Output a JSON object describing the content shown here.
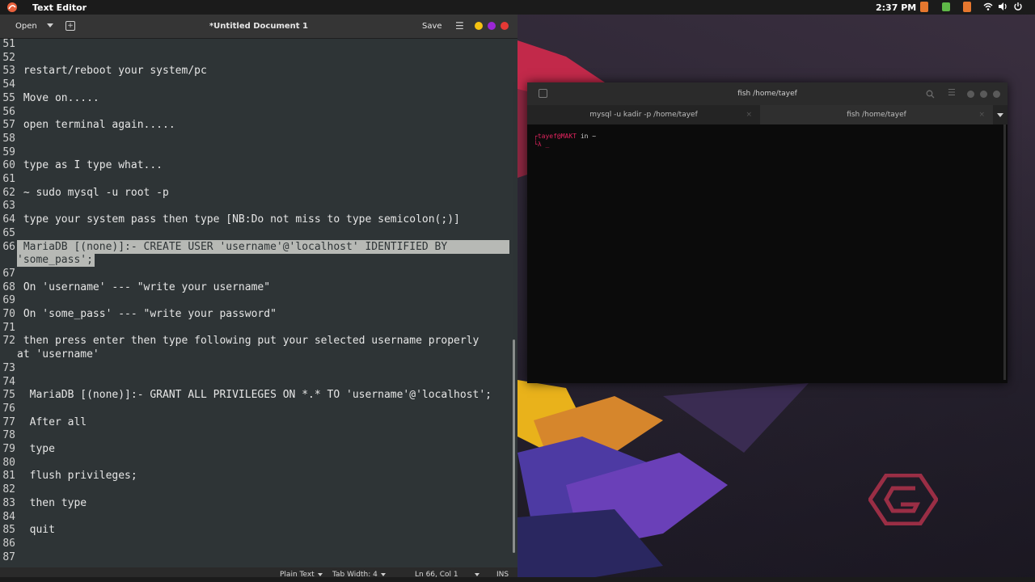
{
  "top_panel": {
    "app_title": "Text Editor",
    "clock": "2:37 PM"
  },
  "editor": {
    "open_label": "Open",
    "window_title": "*Untitled Document 1",
    "save_label": "Save",
    "lines": [
      {
        "num": "51",
        "text": ""
      },
      {
        "num": "52",
        "text": ""
      },
      {
        "num": "53",
        "text": " restart/reboot your system/pc"
      },
      {
        "num": "54",
        "text": ""
      },
      {
        "num": "55",
        "text": " Move on....."
      },
      {
        "num": "56",
        "text": ""
      },
      {
        "num": "57",
        "text": " open terminal again....."
      },
      {
        "num": "58",
        "text": ""
      },
      {
        "num": "59",
        "text": ""
      },
      {
        "num": "60",
        "text": " type as I type what..."
      },
      {
        "num": "61",
        "text": ""
      },
      {
        "num": "62",
        "text": " ~ sudo mysql -u root -p"
      },
      {
        "num": "63",
        "text": ""
      },
      {
        "num": "64",
        "text": " type your system pass then type [NB:Do not miss to type semicolon(;)]"
      },
      {
        "num": "65",
        "text": ""
      },
      {
        "num": "66",
        "text": " MariaDB [(none)]:- CREATE USER 'username'@'localhost' IDENTIFIED BY"
      },
      {
        "num": "",
        "text": "'some_pass';"
      },
      {
        "num": "67",
        "text": ""
      },
      {
        "num": "68",
        "text": " On 'username' --- \"write your username\""
      },
      {
        "num": "69",
        "text": ""
      },
      {
        "num": "70",
        "text": " On 'some_pass' --- \"write your password\""
      },
      {
        "num": "71",
        "text": ""
      },
      {
        "num": "72",
        "text": " then press enter then type following put your selected username properly"
      },
      {
        "num": "",
        "text": "at 'username'"
      },
      {
        "num": "73",
        "text": ""
      },
      {
        "num": "74",
        "text": ""
      },
      {
        "num": "75",
        "text": "  MariaDB [(none)]:- GRANT ALL PRIVILEGES ON *.* TO 'username'@'localhost';"
      },
      {
        "num": "76",
        "text": ""
      },
      {
        "num": "77",
        "text": "  After all"
      },
      {
        "num": "78",
        "text": ""
      },
      {
        "num": "79",
        "text": "  type"
      },
      {
        "num": "80",
        "text": ""
      },
      {
        "num": "81",
        "text": "  flush privileges;"
      },
      {
        "num": "82",
        "text": ""
      },
      {
        "num": "83",
        "text": "  then type"
      },
      {
        "num": "84",
        "text": ""
      },
      {
        "num": "85",
        "text": "  quit"
      },
      {
        "num": "86",
        "text": ""
      },
      {
        "num": "87",
        "text": ""
      }
    ],
    "selected_lines": [
      15,
      16
    ],
    "status": {
      "language": "Plain Text",
      "tab_width": "Tab Width: 4",
      "position": "Ln 66, Col 1",
      "mode": "INS"
    }
  },
  "terminal": {
    "title": "fish /home/tayef",
    "tabs": [
      {
        "label": "mysql -u kadir -p /home/tayef"
      },
      {
        "label": "fish /home/tayef"
      }
    ],
    "prompt_user": "tayef",
    "prompt_host": "@MAKT",
    "prompt_suffix": " in ~",
    "prompt_line2": "λ _"
  },
  "colors": {
    "accent_red": "#e0245e",
    "dot_yellow": "#f5c211",
    "dot_purple": "#9b26d6",
    "dot_red": "#e53935"
  }
}
